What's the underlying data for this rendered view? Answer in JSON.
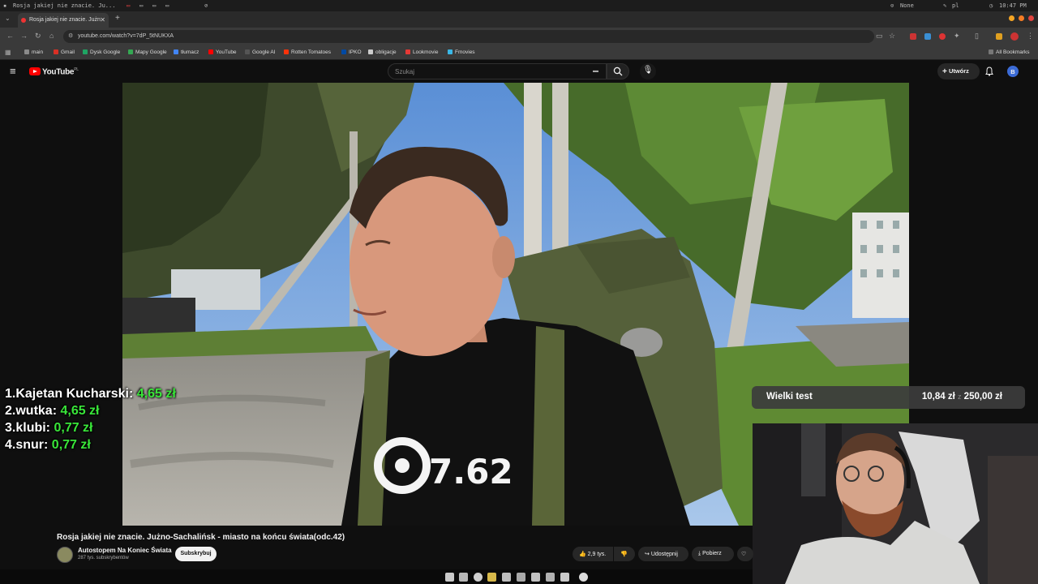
{
  "os_bar": {
    "window_title": "Rosja jakiej nie znacie. Ju...",
    "indicator_none": "None",
    "keyboard_lang": "pl",
    "clock": "10:47 PM"
  },
  "browser": {
    "tab_title": "Rosja jakiej nie znacie. Jużn",
    "url": "youtube.com/watch?v=7dP_5tNUKXA",
    "bookmarks": [
      {
        "label": "main",
        "color": "#8a8a8a"
      },
      {
        "label": "Gmail",
        "color": "#d93025"
      },
      {
        "label": "Dysk Google",
        "color": "#1fa463"
      },
      {
        "label": "Mapy Google",
        "color": "#34a853"
      },
      {
        "label": "tłumacz",
        "color": "#4285f4"
      },
      {
        "label": "YouTube",
        "color": "#ff0000"
      },
      {
        "label": "Google AI",
        "color": "#555555"
      },
      {
        "label": "Rotten Tomatoes",
        "color": "#fa320a"
      },
      {
        "label": "IPKO",
        "color": "#0049a3"
      },
      {
        "label": "obligacje",
        "color": "#cccccc"
      },
      {
        "label": "Lookmovie",
        "color": "#e53935"
      },
      {
        "label": "Fmovies",
        "color": "#3ab7e6"
      }
    ],
    "all_bookmarks": "All Bookmarks"
  },
  "youtube": {
    "logo_text": "YouTube",
    "logo_region": "PL",
    "search_placeholder": "Szukaj",
    "create_label": "Utwórz",
    "avatar_letter": "B"
  },
  "overlay": {
    "leaderboard": [
      {
        "rank": "1.",
        "name": "Kajetan Kucharski:",
        "amount": "4,65 zł"
      },
      {
        "rank": "2.",
        "name": "wutka:",
        "amount": "4,65 zł"
      },
      {
        "rank": "3.",
        "name": "klubi:",
        "amount": "0,77 zł"
      },
      {
        "rank": "4.",
        "name": "snur:",
        "amount": "0,77 zł"
      }
    ],
    "goal_label": "Wielki test",
    "goal_current": "10,84 zł",
    "goal_separator": "z",
    "goal_target": "250,00 zł"
  },
  "video": {
    "shirt_logo_text": "7.62",
    "title": "Rosja jakiej nie znacie. Jużno-Sachalińsk - miasto na końcu świata(odc.42)",
    "channel_name": "Autostopem Na Koniec Świata",
    "channel_subs": "287 tys. subskrybentów",
    "subscribe_label": "Subskrybuj",
    "likes": "2,9 tys.",
    "share_label": "Udostępnij",
    "download_label": "Pobierz"
  },
  "colors": {
    "youtube_red": "#ff0000",
    "donation_green": "#39e639",
    "page_bg": "#0f0f0f"
  }
}
